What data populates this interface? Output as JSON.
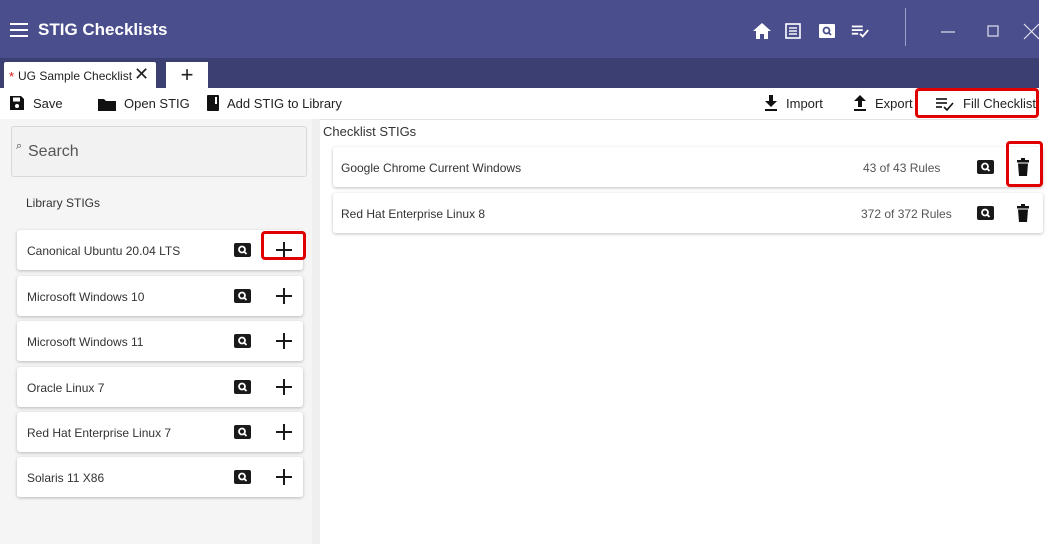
{
  "app": {
    "title": "STIG Checklists"
  },
  "tabs": [
    {
      "label": "UG Sample Checklist",
      "modified_mark": "*",
      "close": "✕"
    }
  ],
  "tab_add": "+",
  "toolbar": {
    "save": "Save",
    "open_stig": "Open STIG",
    "add_stig": "Add STIG to Library",
    "import": "Import",
    "export": "Export",
    "fill_checklist": "Fill Checklist"
  },
  "search": {
    "placeholder": "Search",
    "icon": "⌕"
  },
  "library": {
    "title": "Library STIGs",
    "items": [
      {
        "name": "Canonical Ubuntu 20.04 LTS"
      },
      {
        "name": "Microsoft Windows 10"
      },
      {
        "name": "Microsoft Windows 11"
      },
      {
        "name": "Oracle Linux 7"
      },
      {
        "name": "Red Hat Enterprise Linux 7"
      },
      {
        "name": "Solaris 11 X86"
      }
    ]
  },
  "checklist": {
    "title": "Checklist STIGs",
    "items": [
      {
        "name": "Google Chrome Current Windows",
        "rules": "43 of 43 Rules"
      },
      {
        "name": "Red Hat Enterprise Linux 8",
        "rules": "372 of 372 Rules"
      }
    ]
  },
  "icons": {
    "menu": "hamburger-icon",
    "home": "home-icon",
    "list": "list-icon",
    "preview": "preview-icon",
    "checklist": "playlist-check-icon",
    "minimize": "minimize-icon",
    "maximize": "maximize-icon",
    "close": "close-icon"
  },
  "colors": {
    "titlebar": "#4a4e8c",
    "tabstrip": "#3c3f72",
    "highlight": "#e00000"
  }
}
